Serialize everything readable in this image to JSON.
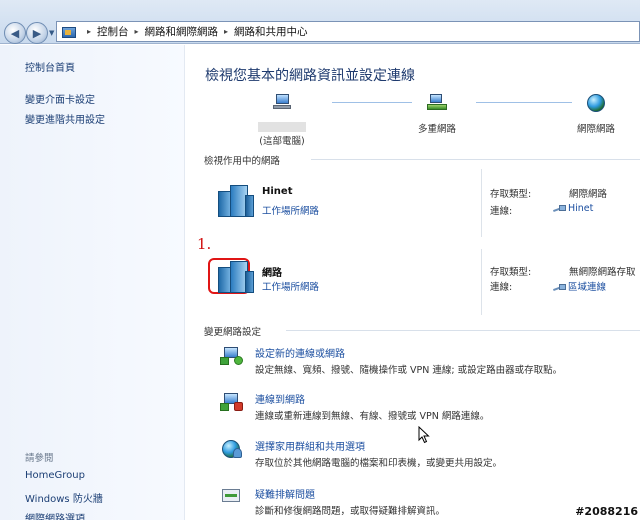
{
  "address": {
    "crumbs": [
      "控制台",
      "網路和網際網路",
      "網路和共用中心"
    ],
    "separator": "▸"
  },
  "nav": {
    "back_icon": "back-arrow-icon",
    "forward_icon": "forward-arrow-icon"
  },
  "sidebar": {
    "links": [
      "控制台首頁",
      "變更介面卡設定",
      "變更進階共用設定"
    ],
    "see_also_label": "請參閱",
    "see_also": [
      "HomeGroup",
      "Windows 防火牆",
      "網際網路選項"
    ]
  },
  "main": {
    "title": "檢視您基本的網路資訊並設定連線",
    "map": {
      "this_pc": "(這部電腦)",
      "multi": "多重網路",
      "internet": "網際網路"
    },
    "active_networks_label": "檢視作用中的網路",
    "networks": [
      {
        "name": "Hinet",
        "type": "工作場所網路",
        "access_label": "存取類型:",
        "access_value": "網際網路",
        "conn_label": "連線:",
        "conn_value": "Hinet"
      },
      {
        "name": "網路",
        "type": "工作場所網路",
        "access_label": "存取類型:",
        "access_value": "無網際網路存取",
        "conn_label": "連線:",
        "conn_value": "區域連線"
      }
    ],
    "annotation": "1.",
    "change_settings_label": "變更網路設定",
    "tasks": [
      {
        "title": "設定新的連線或網路",
        "desc": "設定無線、寬頻、撥號、隨機操作或 VPN 連線; 或設定路由器或存取點。"
      },
      {
        "title": "連線到網路",
        "desc": "連線或重新連線到無線、有線、撥號或 VPN 網路連線。"
      },
      {
        "title": "選擇家用群組和共用選項",
        "desc": "存取位於其他網路電腦的檔案和印表機，或變更共用設定。"
      },
      {
        "title": "疑難排解問題",
        "desc": "診斷和修復網路問題，或取得疑難排解資訊。"
      }
    ]
  },
  "watermark": "#2088216",
  "colors": {
    "link": "#1c4fa0",
    "title": "#1e3a6e",
    "annotation": "#e01515"
  }
}
